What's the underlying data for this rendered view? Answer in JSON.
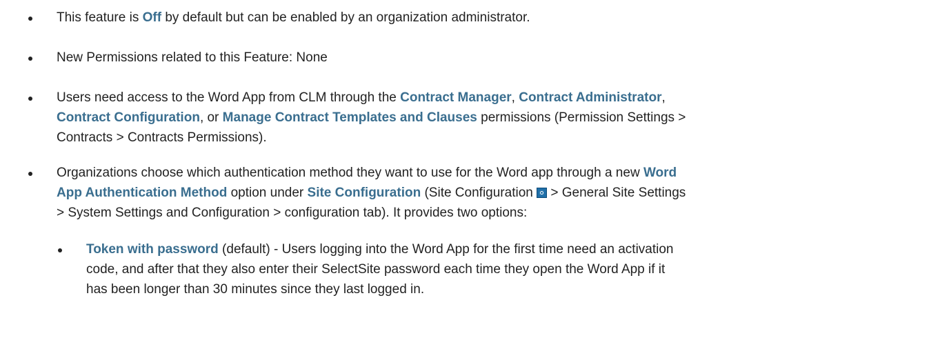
{
  "bullets": [
    {
      "lines": [
        [
          {
            "t": "This feature is ",
            "kw": false
          },
          {
            "t": "Off",
            "kw": true
          },
          {
            "t": " by default but can be enabled by an organization administrator.",
            "kw": false
          }
        ]
      ]
    },
    {
      "lines": [
        [
          {
            "t": "New Permissions related to this Feature: None",
            "kw": false
          }
        ]
      ]
    },
    {
      "lines": [
        [
          {
            "t": "Users need access to the Word App from CLM through the ",
            "kw": false
          },
          {
            "t": "Contract Manager",
            "kw": true
          },
          {
            "t": ", ",
            "kw": false
          },
          {
            "t": "Contract Administrator",
            "kw": true
          },
          {
            "t": ",",
            "kw": false
          }
        ],
        [
          {
            "t": "Contract Configuration",
            "kw": true
          },
          {
            "t": ", or ",
            "kw": false
          },
          {
            "t": "Manage Contract Templates and Clauses",
            "kw": true
          },
          {
            "t": " permissions (Permission Settings >",
            "kw": false
          }
        ],
        [
          {
            "t": "Contracts > Contracts Permissions).",
            "kw": false
          }
        ]
      ]
    },
    {
      "lines": [
        [
          {
            "t": "Organizations choose which authentication method they want to use for the Word app through a new ",
            "kw": false
          },
          {
            "t": "Word",
            "kw": true
          }
        ],
        [
          {
            "t": "App Authentication Method",
            "kw": true
          },
          {
            "t": " option under ",
            "kw": false
          },
          {
            "t": "Site Configuration",
            "kw": true
          },
          {
            "t": " (Site Configuration ",
            "kw": false
          },
          {
            "icon": "gear-icon"
          },
          {
            "t": " > General Site Settings",
            "kw": false
          }
        ],
        [
          {
            "t": "> System Settings and Configuration > configuration tab). It provides two options:",
            "kw": false
          }
        ]
      ]
    }
  ],
  "sub_bullets": [
    {
      "lines": [
        [
          {
            "t": "Token with password",
            "kw": true
          },
          {
            "t": " (default) - Users logging into the Word App for the first time need an activation",
            "kw": false
          }
        ],
        [
          {
            "t": "code, and after that they also enter their SelectSite password each time they open the Word App if it",
            "kw": false
          }
        ],
        [
          {
            "t": "has been longer than 30 minutes since they last logged in.",
            "kw": false
          }
        ]
      ]
    }
  ],
  "colors": {
    "text": "#222222",
    "keyword": "#3a6e8f",
    "icon": "#1f6fa8"
  }
}
